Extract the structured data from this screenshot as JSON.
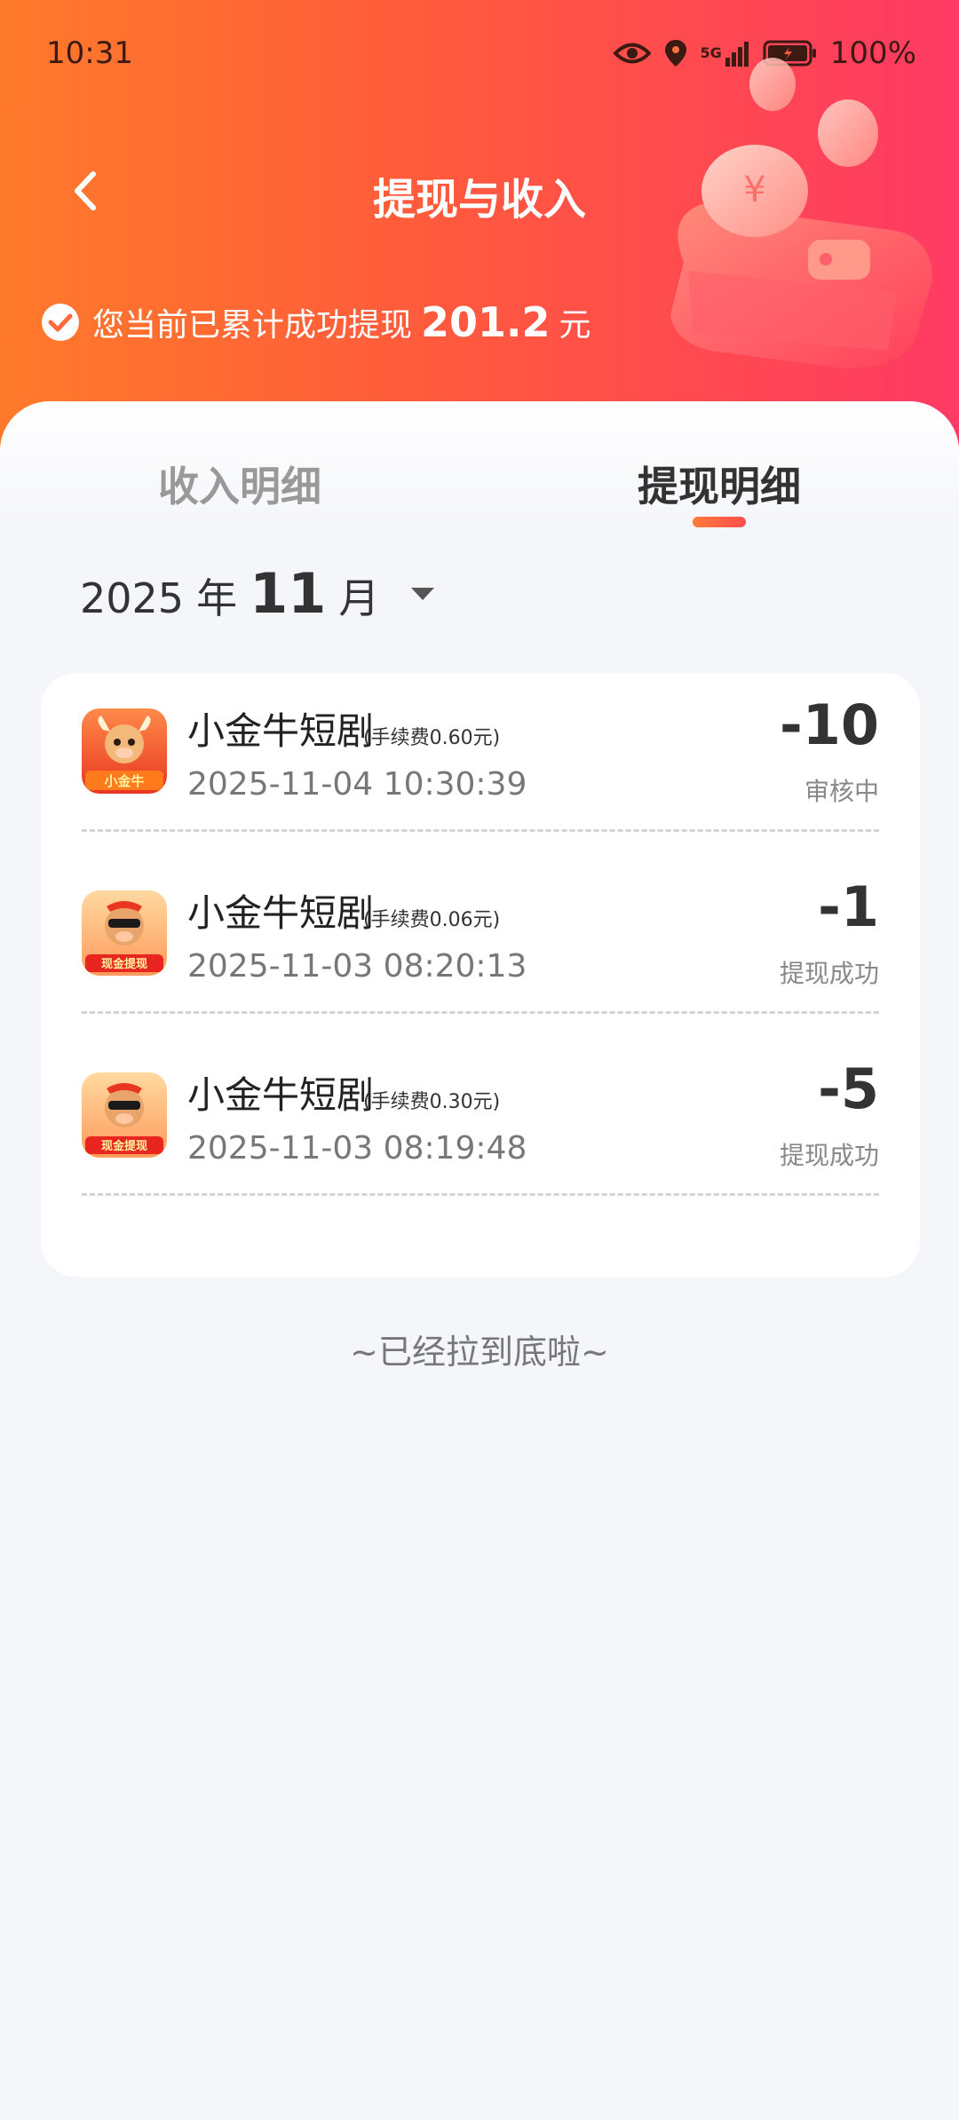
{
  "status_bar": {
    "time": "10:31",
    "signal_label": "5G",
    "battery": "100%"
  },
  "header": {
    "title": "提现与收入",
    "summary_prefix": "您当前已累计成功提现",
    "summary_amount": "201.2",
    "summary_unit": "元"
  },
  "tabs": [
    {
      "label": "收入明细",
      "active": false
    },
    {
      "label": "提现明细",
      "active": true
    }
  ],
  "month_picker": {
    "year": "2025",
    "year_unit": "年",
    "month": "11",
    "month_unit": "月"
  },
  "records": [
    {
      "name": "小金牛短剧",
      "fee": "(手续费0.60元)",
      "time": "2025-11-04 10:30:39",
      "amount": "-10",
      "status": "审核中",
      "icon": "xiaojinniu-app-icon"
    },
    {
      "name": "小金牛短剧",
      "fee": "(手续费0.06元)",
      "time": "2025-11-03 08:20:13",
      "amount": "-1",
      "status": "提现成功",
      "icon": "cash-withdraw-app-icon"
    },
    {
      "name": "小金牛短剧",
      "fee": "(手续费0.30元)",
      "time": "2025-11-03 08:19:48",
      "amount": "-5",
      "status": "提现成功",
      "icon": "cash-withdraw-app-icon"
    }
  ],
  "icon_badges": {
    "xiaojinniu": "小金牛",
    "cash": "现金提现"
  },
  "end_text": "~已经拉到底啦~",
  "colors": {
    "header_start": "#ff7a2a",
    "header_end": "#ff3a64",
    "accent": "#ff4e4e",
    "background": "#f5f6fa"
  }
}
